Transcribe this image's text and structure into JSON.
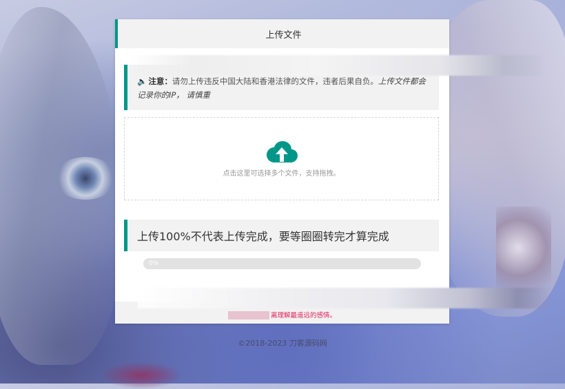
{
  "card": {
    "title": "上传文件"
  },
  "notice": {
    "icon": "speaker-icon",
    "label": "注意：",
    "text": "请勿上传违反中国大陆和香港法律的文件，违者后果自负。",
    "italic_text": "上传文件都会记录你的IP， 请慎重"
  },
  "upload": {
    "icon": "cloud-upload-icon",
    "icon_color": "#009688",
    "hint": "点击这里可选择多个文件，支持拖拽。"
  },
  "progress": {
    "tip": "上传100%不代表上传完成，要等圈圈转完才算完成",
    "value": 0,
    "label": "0%"
  },
  "footer": {
    "quote": "离理解最遥远的感情。"
  },
  "page": {
    "copyright": "©2018-2023 刀客源码网"
  },
  "colors": {
    "accent": "#009688",
    "quote": "#e0245e"
  }
}
